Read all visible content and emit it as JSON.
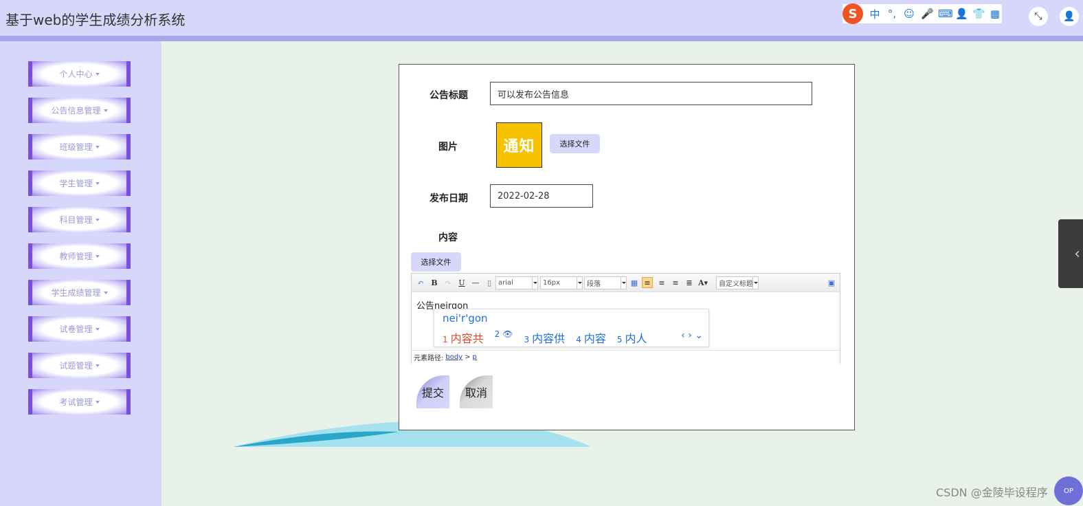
{
  "app": {
    "title": "基于web的学生成绩分析系统"
  },
  "ime_toolbar": {
    "logo": "S",
    "items": [
      "中",
      "°,",
      "☺",
      "🎤",
      "⌨",
      "👤",
      "👕",
      "▦"
    ]
  },
  "header": {
    "expand_icon": "⤡",
    "user_icon": "👤"
  },
  "sidebar": {
    "items": [
      {
        "label": "个人中心"
      },
      {
        "label": "公告信息管理"
      },
      {
        "label": "班级管理"
      },
      {
        "label": "学生管理"
      },
      {
        "label": "科目管理"
      },
      {
        "label": "教师管理"
      },
      {
        "label": "学生成绩管理"
      },
      {
        "label": "试卷管理"
      },
      {
        "label": "试题管理"
      },
      {
        "label": "考试管理"
      }
    ]
  },
  "form": {
    "title_label": "公告标题",
    "title_value": "可以发布公告信息",
    "image_label": "图片",
    "image_text": "通知",
    "image_file_button": "选择文件",
    "date_label": "发布日期",
    "date_value": "2022-02-28",
    "content_label": "内容",
    "content_file_button": "选择文件",
    "submit_label": "提交",
    "cancel_label": "取消"
  },
  "editor": {
    "font_family": "arial",
    "font_size": "16px",
    "paragraph": "段落",
    "custom_title": "自定义标题",
    "content": "公告neirgon",
    "path_label": "元素路径:",
    "path_body": "body",
    "path_sep": ">",
    "path_p": "p"
  },
  "ime_popup": {
    "composition": "nei'r'gon",
    "candidates": [
      {
        "num": "1",
        "text": "内容共"
      },
      {
        "num": "2",
        "text": "👁"
      },
      {
        "num": "3",
        "text": "内容供"
      },
      {
        "num": "4",
        "text": "内容"
      },
      {
        "num": "5",
        "text": "内人"
      }
    ],
    "nav": "‹ › ⌄"
  },
  "watermark": "CSDN @金陵毕设程序",
  "corner_button": "OP",
  "colors": {
    "sidebar_bg": "#d6d7fb",
    "menu_border": "#7a4fdb",
    "content_bg": "#e8f1ea",
    "notice_yellow": "#f7c200"
  }
}
